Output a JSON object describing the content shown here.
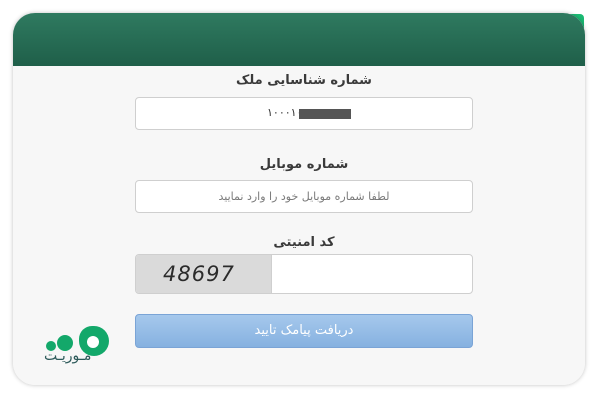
{
  "form": {
    "property_id_label": "شماره شناسایی ملک",
    "property_id_value": "۱۰۰۰۱۰",
    "mobile_label": "شماره موبایل",
    "mobile_placeholder": "لطفا شماره موبایل خود را وارد نمایید",
    "captcha_label": "کد امنیتی",
    "captcha_code": "48697",
    "submit_label": "دریافت پیامک تایید"
  },
  "brand": {
    "logo_text": "مـوریـت"
  },
  "colors": {
    "header": "#1f5f49",
    "accent": "#12a564",
    "button": "#86b1e0"
  }
}
